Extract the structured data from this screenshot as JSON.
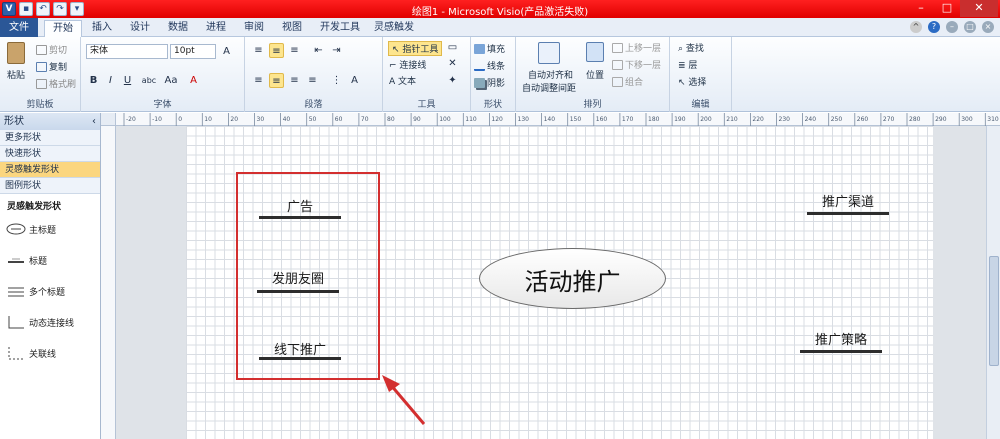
{
  "window": {
    "title": "绘图1 - Microsoft Visio(产品激活失败)",
    "qat_icons": [
      "visio-app-icon",
      "save-icon",
      "undo-icon",
      "redo-icon",
      "customize-qat-icon"
    ],
    "controls": [
      "minimize",
      "maximize",
      "close"
    ]
  },
  "tabs": [
    "文件",
    "开始",
    "插入",
    "设计",
    "数据",
    "进程",
    "审阅",
    "视图",
    "开发工具",
    "灵感触发"
  ],
  "active_tab": "开始",
  "ribbon": {
    "clipboard": {
      "paste": "粘贴",
      "cut": "剪切",
      "copy": "复制",
      "format_painter": "格式刷",
      "label": "剪贴板"
    },
    "font": {
      "family": "宋体",
      "size": "10pt",
      "label": "字体",
      "buttons": [
        "B",
        "I",
        "U",
        "abc",
        "Aa",
        "A"
      ]
    },
    "paragraph": {
      "label": "段落"
    },
    "tools": {
      "pointer": "指针工具",
      "connector": "连接线",
      "text": "文本",
      "label": "工具"
    },
    "shape": {
      "fill": "填充",
      "line": "线条",
      "shadow": "阴影",
      "label": "形状"
    },
    "arrange": {
      "auto_align": "自动对齐和",
      "auto_space": "自动调整间距",
      "position": "位置",
      "bring_forward": "上移一层",
      "send_backward": "下移一层",
      "group": "组合",
      "label": "排列"
    },
    "editing": {
      "find": "查找",
      "layers": "层",
      "select": "选择",
      "label": "编辑"
    }
  },
  "ruler": {
    "ticks": [
      "-20",
      "-10",
      "0",
      "10",
      "20",
      "30",
      "40",
      "50",
      "60",
      "70",
      "80",
      "90",
      "100",
      "110",
      "120",
      "130",
      "140",
      "150",
      "160",
      "170",
      "180",
      "190",
      "200",
      "210",
      "220",
      "230",
      "240",
      "250",
      "260",
      "270",
      "280",
      "290",
      "300",
      "310"
    ]
  },
  "shapes_pane": {
    "title": "形状",
    "rows": [
      "更多形状",
      "快速形状",
      "灵感触发形状",
      "图例形状"
    ],
    "active_row": "灵感触发形状",
    "stencil_title": "灵感触发形状",
    "stencil_items": [
      "主标题",
      "标题",
      "多个标题",
      "动态连接线",
      "关联线"
    ]
  },
  "diagram": {
    "main_topic": "活动推广",
    "left_topics": [
      "广告",
      "发朋友圈",
      "线下推广"
    ],
    "right_topics": [
      "推广渠道",
      "推广策略"
    ],
    "highlight_color": "#d32f2f"
  }
}
